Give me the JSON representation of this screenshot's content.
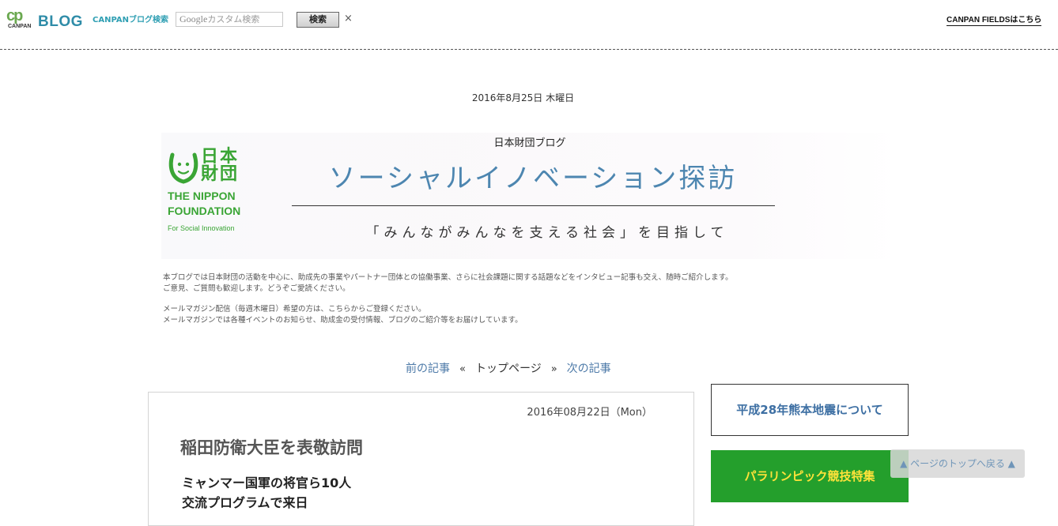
{
  "topbar": {
    "logo_mark": "cp",
    "logo_sub": "CANPAN",
    "blog_word": "BLOG",
    "search_label": "CANPANブログ検索",
    "search_google_word": "Google",
    "search_placeholder": "カスタム検索",
    "search_button": "検索",
    "close_glyph": "×",
    "fields_link": "CANPAN FIELDSはこちら"
  },
  "header": {
    "date": "2016年8月25日 木曜日",
    "kicker": "日本財団ブログ",
    "title": "ソーシャルイノベーション探訪",
    "subtitle": "「みんながみんなを支える社会」を目指して",
    "logo": {
      "kanji_line1": "日本",
      "kanji_line2": "財団",
      "name_line1": "THE NIPPON",
      "name_line2": "FOUNDATION",
      "tagline": "For Social Innovation"
    }
  },
  "intro": {
    "line1": "本ブログでは日本財団の活動を中心に、助成先の事業やパートナー団体との協働事業、さらに社会課題に関する話題などをインタビュー記事も交え、随時ご紹介します。",
    "line2": "ご意見、ご質問も歓迎します。どうぞご愛読ください。",
    "line3": "メールマガジン配信（毎週木曜日）希望の方は、こちらからご登録ください。",
    "line4": "メールマガジンでは各種イベントのお知らせ、助成金の受付情報、ブログのご紹介等をお届けしています。"
  },
  "nav": {
    "prev": "前の記事",
    "sep1": "«",
    "top": "トップページ",
    "sep2": "»",
    "next": "次の記事"
  },
  "article": {
    "date": "2016年08月22日（Mon）",
    "title": "稲田防衛大臣を表敬訪問",
    "lead_line1": "ミャンマー国軍の将官ら10人",
    "lead_line2": "交流プログラムで来日"
  },
  "sidebar": {
    "box1": "平成28年熊本地震について",
    "box2": "パラリンピック競技特集"
  },
  "back_to_top": "▲ ページのトップへ戻る ▲",
  "colors": {
    "blog_blue": "#2f8ca8",
    "title_blue": "#4d86b0",
    "nippon_green": "#3aa535",
    "side_green": "#249f2c",
    "side_yellow": "#ffe23a"
  }
}
